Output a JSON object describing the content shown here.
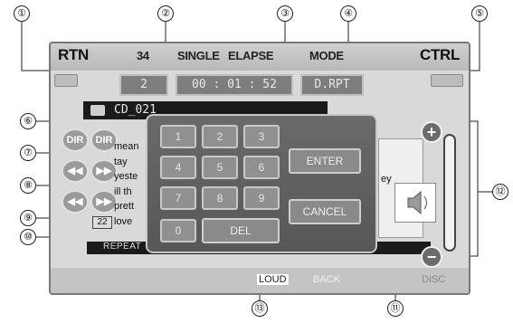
{
  "callouts": [
    "①",
    "②",
    "③",
    "④",
    "⑤",
    "⑥",
    "⑦",
    "⑧",
    "⑨",
    "⑩",
    "⑪",
    "⑫",
    "⑬"
  ],
  "top_bar": {
    "rtn": "RTN",
    "track_count": "34",
    "single": "SINGLE",
    "elapse": "ELAPSE",
    "mode": "MODE",
    "ctrl": "CTRL"
  },
  "values": {
    "track": "2",
    "time": "00 : 01 : 52",
    "mode": "D.RPT"
  },
  "cd_title": "CD_021",
  "side_buttons": {
    "row1_left": "DIR",
    "row1_right": "DIR",
    "row2_left": "◀◀",
    "row2_right": "▶▶",
    "row3_left": "◀◀",
    "row3_right": "▶▶"
  },
  "lyrics": [
    "mean",
    "tay",
    "yeste",
    "ill th",
    "prett",
    "love"
  ],
  "lyric_fragment_right": "ey",
  "track_number": "22",
  "repeat_label": "REPEAT",
  "keypad": {
    "keys": [
      "1",
      "2",
      "3",
      "4",
      "5",
      "6",
      "7",
      "8",
      "9",
      "0"
    ],
    "enter": "ENTER",
    "cancel": "CANCEL",
    "del": "DEL"
  },
  "bottom": {
    "left_label": "LOUD",
    "right_label": "BACK",
    "far_right": "DISC"
  },
  "volume": {
    "plus": "+",
    "minus": "−"
  }
}
